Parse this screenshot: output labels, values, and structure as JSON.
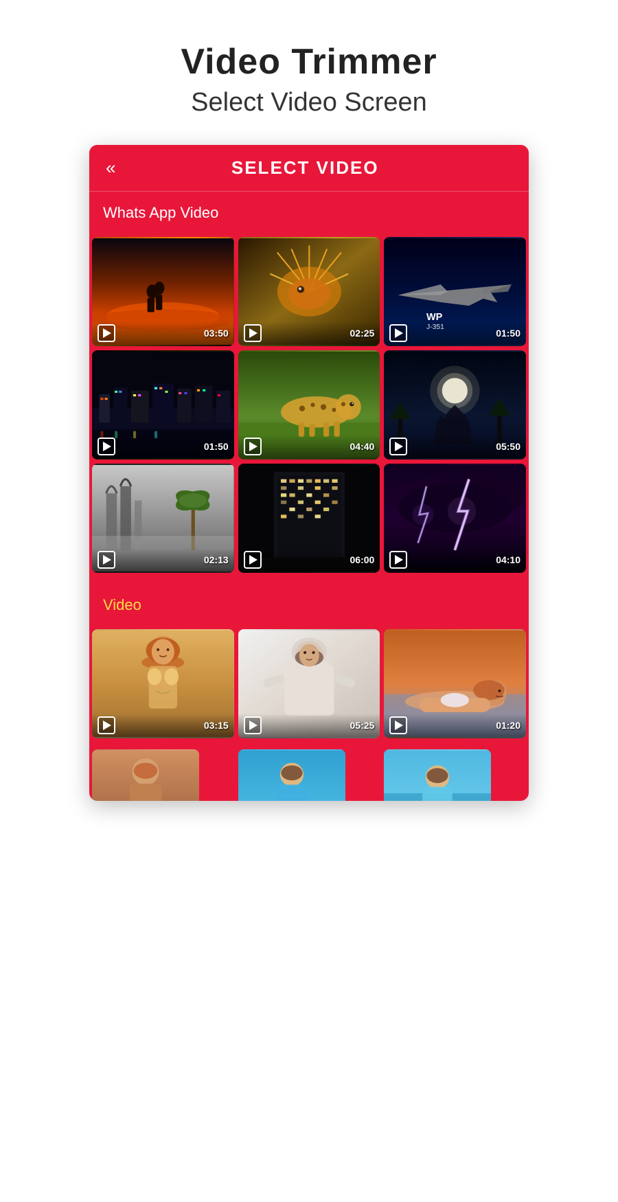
{
  "header": {
    "title": "Video Trimmer",
    "subtitle": "Select Video Screen"
  },
  "toolbar": {
    "title": "SELECT VIDEO",
    "back_label": "«"
  },
  "sections": [
    {
      "id": "whatsapp",
      "label": "Whats App Video",
      "label_color": "white",
      "videos": [
        {
          "id": "v1",
          "duration": "03:50",
          "theme": "thumb-sunset"
        },
        {
          "id": "v2",
          "duration": "02:25",
          "theme": "thumb-fish"
        },
        {
          "id": "v3",
          "duration": "01:50",
          "theme": "thumb-jet"
        },
        {
          "id": "v4",
          "duration": "01:50",
          "theme": "thumb-city"
        },
        {
          "id": "v5",
          "duration": "04:40",
          "theme": "thumb-cheetah"
        },
        {
          "id": "v6",
          "duration": "05:50",
          "theme": "thumb-moon"
        },
        {
          "id": "v7",
          "duration": "02:13",
          "theme": "thumb-ruins"
        },
        {
          "id": "v8",
          "duration": "06:00",
          "theme": "thumb-building"
        },
        {
          "id": "v9",
          "duration": "04:10",
          "theme": "thumb-lightning"
        }
      ]
    },
    {
      "id": "video",
      "label": "Video",
      "label_color": "yellow",
      "videos": [
        {
          "id": "v10",
          "duration": "03:15",
          "theme": "thumb-woman1"
        },
        {
          "id": "v11",
          "duration": "05:25",
          "theme": "thumb-woman2"
        },
        {
          "id": "v12",
          "duration": "01:20",
          "theme": "thumb-woman3"
        }
      ],
      "partial_videos": [
        {
          "id": "v13",
          "theme": "thumb-partial1"
        },
        {
          "id": "v14",
          "theme": "thumb-partial2"
        },
        {
          "id": "v15",
          "theme": "thumb-partial3"
        }
      ]
    }
  ],
  "colors": {
    "app_bg": "#e8173a",
    "accent_yellow": "#ffdd44"
  }
}
